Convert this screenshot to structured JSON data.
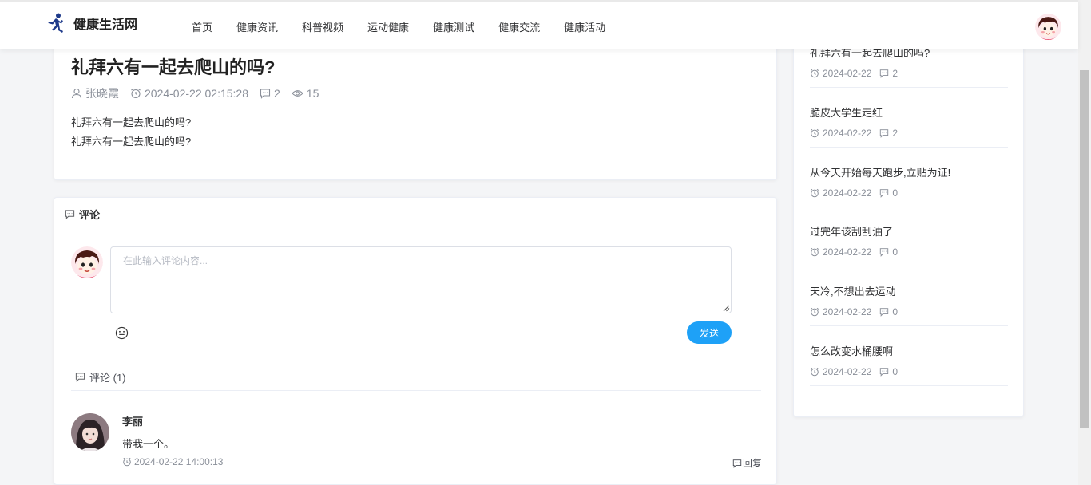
{
  "header": {
    "site_name": "健康生活网",
    "nav": [
      "首页",
      "健康资讯",
      "科普视频",
      "运动健康",
      "健康测试",
      "健康交流",
      "健康活动"
    ]
  },
  "article": {
    "title": "礼拜六有一起去爬山的吗?",
    "author": "张晓霞",
    "datetime": "2024-02-22 02:15:28",
    "comments": "2",
    "views": "15",
    "body": [
      "礼拜六有一起去爬山的吗?",
      "礼拜六有一起去爬山的吗?"
    ]
  },
  "comment_section": {
    "header": "评论",
    "placeholder": "在此输入评论内容...",
    "send_label": "发送",
    "count_label": "评论 (1)",
    "comments": [
      {
        "user": "李丽",
        "text": "带我一个。",
        "time": "2024-02-22 14:00:13",
        "reply_label": "回复"
      }
    ]
  },
  "sidebar": {
    "items": [
      {
        "title": "礼拜六有一起去爬山的吗?",
        "date": "2024-02-22",
        "comments": "2"
      },
      {
        "title": "脆皮大学生走红",
        "date": "2024-02-22",
        "comments": "2"
      },
      {
        "title": "从今天开始每天跑步,立贴为证!",
        "date": "2024-02-22",
        "comments": "0"
      },
      {
        "title": "过完年该刮刮油了",
        "date": "2024-02-22",
        "comments": "0"
      },
      {
        "title": "天冷,不想出去运动",
        "date": "2024-02-22",
        "comments": "0"
      },
      {
        "title": "怎么改变水桶腰啊",
        "date": "2024-02-22",
        "comments": "0"
      }
    ]
  },
  "colors": {
    "accent": "#1ea1f7",
    "logo": "#1e3a8a",
    "muted": "#8a8f99"
  }
}
